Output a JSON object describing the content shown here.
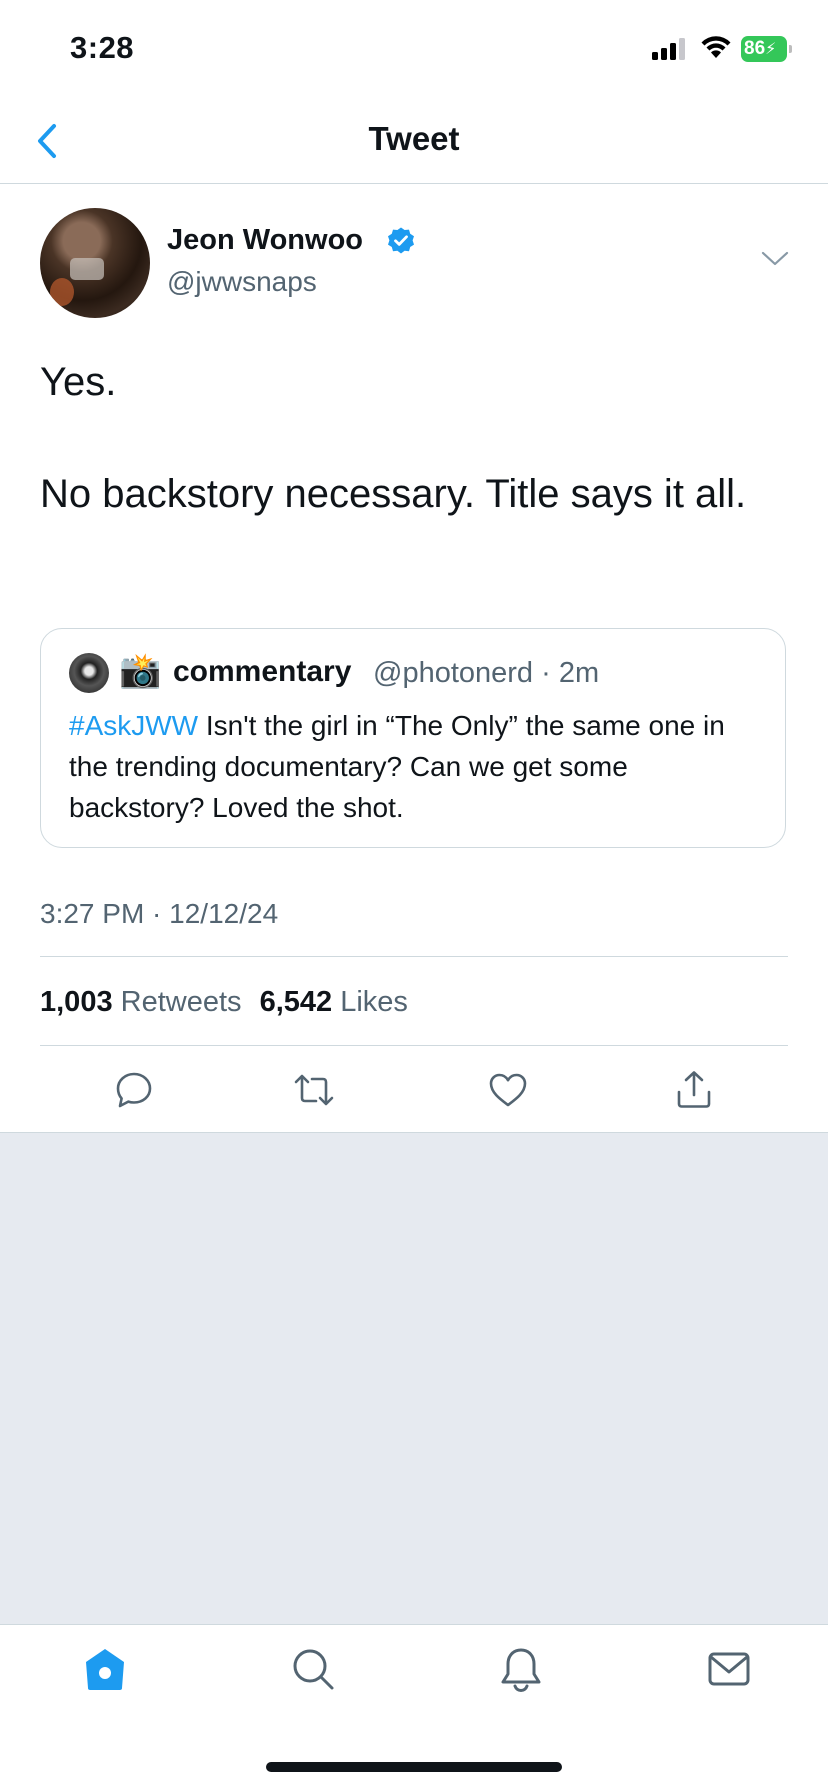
{
  "status_bar": {
    "time": "3:28",
    "battery": "86"
  },
  "header": {
    "title": "Tweet"
  },
  "tweet": {
    "author_name": "Jeon Wonwoo",
    "author_handle": "@jwwsnaps",
    "body_line_1": "Yes.",
    "body_line_2": "No backstory necessary. Title says it all.",
    "timestamp": "3:27 PM · 12/12/24",
    "retweets_count": "1,003",
    "retweets_label": "Retweets",
    "likes_count": "6,542",
    "likes_label": "Likes"
  },
  "quote": {
    "camera_emoji": "📸",
    "name": "commentary",
    "handle_time": "@photonerd · 2m",
    "hashtag": "#AskJWW",
    "text": " Isn't the girl in “The Only” the same one in the trending documentary? Can we get some backstory? Loved the shot."
  },
  "colors": {
    "accent": "#1d9bf0",
    "secondary_text": "#536471",
    "divider": "#cfd9de",
    "battery": "#34c759",
    "empty_background": "#e6eaf0"
  },
  "icons": [
    "back-arrow-icon",
    "verified-badge-icon",
    "chevron-down-icon",
    "reply-icon",
    "retweet-icon",
    "like-icon",
    "share-icon",
    "home-icon",
    "search-icon",
    "notifications-icon",
    "messages-icon"
  ]
}
